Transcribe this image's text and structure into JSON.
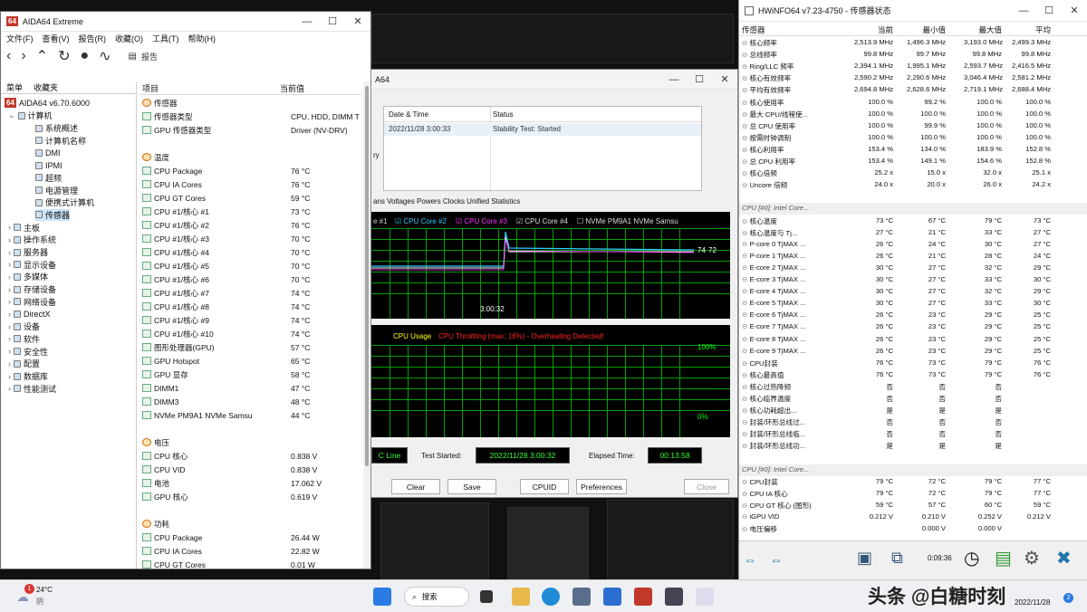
{
  "aida": {
    "title": "AIDA64 Extreme",
    "menu": [
      "文件(F)",
      "查看(V)",
      "报告(R)",
      "收藏(O)",
      "工具(T)",
      "帮助(H)"
    ],
    "report_label": "报告",
    "tabs": [
      "菜单",
      "收藏夹"
    ],
    "version": "AIDA64 v6.70.6000",
    "tree": [
      "计算机",
      "系统概述",
      "计算机名称",
      "DMI",
      "IPMI",
      "超频",
      "电源管理",
      "便携式计算机",
      "传感器",
      "主板",
      "操作系统",
      "服务器",
      "显示设备",
      "多媒体",
      "存储设备",
      "网络设备",
      "DirectX",
      "设备",
      "软件",
      "安全性",
      "配置",
      "数据库",
      "性能测试"
    ],
    "col_item": "项目",
    "col_value": "当前值",
    "rows": [
      {
        "n": "传感器",
        "v": "",
        "s": true
      },
      {
        "n": "传感器类型",
        "v": "CPU, HDD, DIMM T"
      },
      {
        "n": "GPU 传感器类型",
        "v": "Driver  (NV-DRV)"
      },
      {
        "n": "",
        "v": ""
      },
      {
        "n": "温度",
        "v": "",
        "s": true
      },
      {
        "n": "CPU Package",
        "v": "76 °C"
      },
      {
        "n": "CPU IA Cores",
        "v": "76 °C"
      },
      {
        "n": "CPU GT Cores",
        "v": "59 °C"
      },
      {
        "n": "CPU #1/核心 #1",
        "v": "73 °C"
      },
      {
        "n": "CPU #1/核心 #2",
        "v": "76 °C"
      },
      {
        "n": "CPU #1/核心 #3",
        "v": "70 °C"
      },
      {
        "n": "CPU #1/核心 #4",
        "v": "70 °C"
      },
      {
        "n": "CPU #1/核心 #5",
        "v": "70 °C"
      },
      {
        "n": "CPU #1/核心 #6",
        "v": "70 °C"
      },
      {
        "n": "CPU #1/核心 #7",
        "v": "74 °C"
      },
      {
        "n": "CPU #1/核心 #8",
        "v": "74 °C"
      },
      {
        "n": "CPU #1/核心 #9",
        "v": "74 °C"
      },
      {
        "n": "CPU #1/核心 #10",
        "v": "74 °C"
      },
      {
        "n": "图形处理器(GPU)",
        "v": "57 °C"
      },
      {
        "n": "GPU Hotspot",
        "v": "65 °C"
      },
      {
        "n": "GPU 显存",
        "v": "58 °C"
      },
      {
        "n": "DIMM1",
        "v": "47 °C"
      },
      {
        "n": "DIMM3",
        "v": "48 °C"
      },
      {
        "n": "NVMe PM9A1 NVMe Samsu",
        "v": "44 °C"
      },
      {
        "n": "",
        "v": ""
      },
      {
        "n": "电压",
        "v": "",
        "s": true
      },
      {
        "n": "CPU 核心",
        "v": "0.838 V"
      },
      {
        "n": "CPU VID",
        "v": "0.838 V"
      },
      {
        "n": "电池",
        "v": "17.062 V"
      },
      {
        "n": "GPU 核心",
        "v": "0.619 V"
      },
      {
        "n": "",
        "v": ""
      },
      {
        "n": "功耗",
        "v": "",
        "s": true
      },
      {
        "n": "CPU Package",
        "v": "26.44 W"
      },
      {
        "n": "CPU IA Cores",
        "v": "22.82 W"
      },
      {
        "n": "CPU GT Cores",
        "v": "0.01 W"
      }
    ]
  },
  "stability": {
    "title": "A64",
    "ry": "ry",
    "col_date": "Date & Time",
    "col_status": "Status",
    "date": "2022/11/28 3:00:33",
    "status": "Stability Test: Started",
    "tabs": "ans  Voltages  Powers  Clocks  Unified  Statistics",
    "legend1": [
      "e #1",
      "CPU Core #2",
      "CPU Core #3",
      "CPU Core #4",
      "NVMe PM9A1 NVMe Samsu"
    ],
    "time_label": "3:00:32",
    "val74": "74",
    "val72": "72",
    "legend2a": "CPU Usage",
    "legend2b": "CPU Throttling (max: 16%) - Overheating Detected!",
    "p100": "100%",
    "p0": "0%",
    "line": "C Line",
    "started_label": "Test Started:",
    "started": "2022/11/28 3:00:32",
    "elapsed_label": "Elapsed Time:",
    "elapsed": "00:13:58",
    "buttons": [
      "Clear",
      "Save",
      "CPUID",
      "Preferences",
      "Close"
    ]
  },
  "hwinfo": {
    "title": "HWiNFO64 v7.23-4750 - 传感器状态",
    "cols": [
      "传感器",
      "当前",
      "最小值",
      "最大值",
      "平均"
    ],
    "rows": [
      [
        "核心频率",
        "2,513.9 MHz",
        "1,496.3 MHz",
        "3,193.0 MHz",
        "2,499.3 MHz"
      ],
      [
        "总线频率",
        "99.8 MHz",
        "99.7 MHz",
        "99.8 MHz",
        "99.8 MHz"
      ],
      [
        "Ring/LLC 频率",
        "2,394.1 MHz",
        "1,995.1 MHz",
        "2,593.7 MHz",
        "2,416.5 MHz"
      ],
      [
        "核心有效频率",
        "2,590.2 MHz",
        "2,290.6 MHz",
        "3,046.4 MHz",
        "2,581.2 MHz"
      ],
      [
        "平均有效频率",
        "2,694.8 MHz",
        "2,628.6 MHz",
        "2,719.1 MHz",
        "2,688.4 MHz"
      ],
      [
        "核心使用率",
        "100.0 %",
        "99.2 %",
        "100.0 %",
        "100.0 %"
      ],
      [
        "最大 CPU/线程使...",
        "100.0 %",
        "100.0 %",
        "100.0 %",
        "100.0 %"
      ],
      [
        "总 CPU 使用率",
        "100.0 %",
        "99.9 %",
        "100.0 %",
        "100.0 %"
      ],
      [
        "按需时钟调制",
        "100.0 %",
        "100.0 %",
        "100.0 %",
        "100.0 %"
      ],
      [
        "核心利用率",
        "153.4 %",
        "134.0 %",
        "183.9 %",
        "152.8 %"
      ],
      [
        "总 CPU 利用率",
        "153.4 %",
        "149.1 %",
        "154.6 %",
        "152.8 %"
      ],
      [
        "核心倍频",
        "25.2 x",
        "15.0 x",
        "32.0 x",
        "25.1 x"
      ],
      [
        "Uncore 倍频",
        "24.0 x",
        "20.0 x",
        "26.0 x",
        "24.2 x"
      ],
      [
        "",
        "",
        "",
        "",
        ""
      ],
      [
        "CPU [#0]: Intel Core...",
        "",
        "",
        "",
        ""
      ],
      [
        "核心温度",
        "73 °C",
        "67 °C",
        "79 °C",
        "73 °C"
      ],
      [
        "核心温度与 Tj...",
        "27 °C",
        "21 °C",
        "33 °C",
        "27 °C"
      ],
      [
        "P-core 0 TjMAX ...",
        "26 °C",
        "24 °C",
        "30 °C",
        "27 °C"
      ],
      [
        "P-core 1 TjMAX ...",
        "26 °C",
        "21 °C",
        "28 °C",
        "24 °C"
      ],
      [
        "E-core 2 TjMAX ...",
        "30 °C",
        "27 °C",
        "32 °C",
        "29 °C"
      ],
      [
        "E-core 3 TjMAX ...",
        "30 °C",
        "27 °C",
        "33 °C",
        "30 °C"
      ],
      [
        "E-core 4 TjMAX ...",
        "30 °C",
        "27 °C",
        "32 °C",
        "29 °C"
      ],
      [
        "E-core 5 TjMAX ...",
        "30 °C",
        "27 °C",
        "33 °C",
        "30 °C"
      ],
      [
        "E-core 6 TjMAX ...",
        "26 °C",
        "23 °C",
        "29 °C",
        "25 °C"
      ],
      [
        "E-core 7 TjMAX ...",
        "26 °C",
        "23 °C",
        "29 °C",
        "25 °C"
      ],
      [
        "E-core 8 TjMAX ...",
        "26 °C",
        "23 °C",
        "29 °C",
        "25 °C"
      ],
      [
        "E-core 9 TjMAX ...",
        "26 °C",
        "23 °C",
        "29 °C",
        "25 °C"
      ],
      [
        "CPU封装",
        "76 °C",
        "73 °C",
        "79 °C",
        "76 °C"
      ],
      [
        "核心最高值",
        "76 °C",
        "73 °C",
        "79 °C",
        "76 °C"
      ],
      [
        "核心过热降频",
        "否",
        "否",
        "否",
        ""
      ],
      [
        "核心临界温度",
        "否",
        "否",
        "否",
        ""
      ],
      [
        "核心功耗超出...",
        "是",
        "是",
        "是",
        ""
      ],
      [
        "封装/环形总线过...",
        "否",
        "否",
        "否",
        ""
      ],
      [
        "封装/环形总线临...",
        "否",
        "否",
        "否",
        ""
      ],
      [
        "封装/环形总线功...",
        "是",
        "是",
        "是",
        ""
      ],
      [
        "",
        "",
        "",
        "",
        ""
      ],
      [
        "CPU [#0]: Intel Core...",
        "",
        "",
        "",
        ""
      ],
      [
        "CPU封装",
        "79 °C",
        "72 °C",
        "79 °C",
        "77 °C"
      ],
      [
        "CPU IA 核心",
        "79 °C",
        "72 °C",
        "79 °C",
        "77 °C"
      ],
      [
        "CPU GT 核心 (图形)",
        "59 °C",
        "57 °C",
        "60 °C",
        "59 °C"
      ],
      [
        "iGPU VID",
        "0.212 V",
        "0.210 V",
        "0.252 V",
        "0.212 V"
      ],
      [
        "电压偏移",
        "",
        "0.000 V",
        "0.000 V",
        ""
      ]
    ],
    "time": "0:09:36"
  },
  "taskbar": {
    "temp": "24°C",
    "weather": "阴",
    "badge": "1",
    "search": "搜索",
    "watermark": "头条 @白糖时刻",
    "date": "2022/11/28",
    "notif": "2"
  }
}
